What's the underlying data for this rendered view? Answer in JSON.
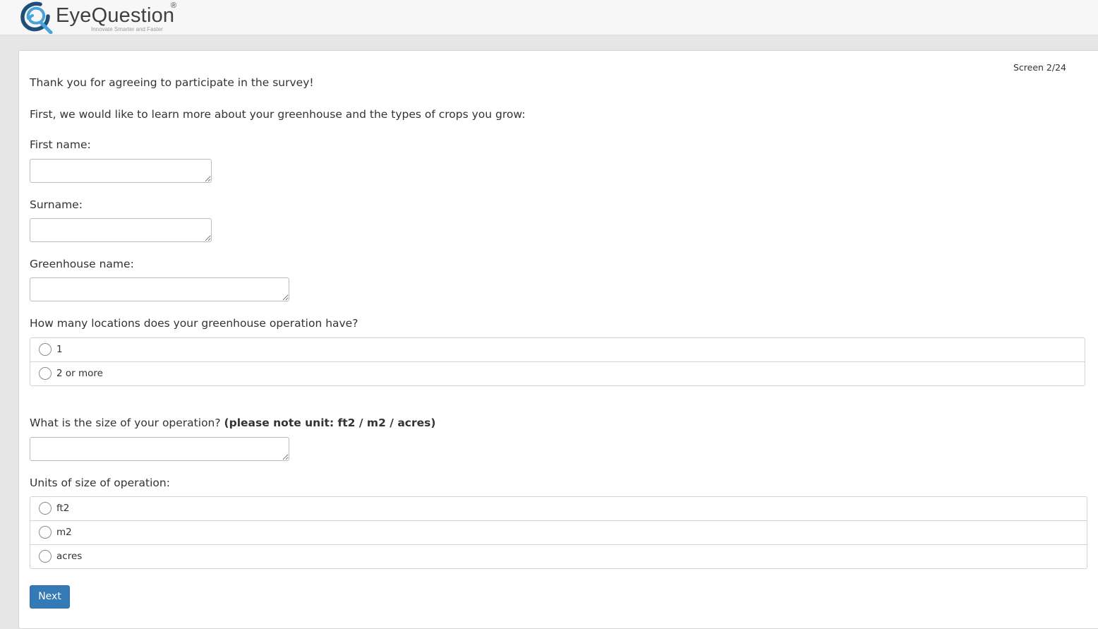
{
  "brand": {
    "logo_icon": "eyequestion-logo-mark",
    "name": "EyeQuestion",
    "registered": "®",
    "tagline": "Innovate Smarter and Faster",
    "colors": {
      "mark_dark": "#1d4f78",
      "mark_light": "#4aa3d8"
    }
  },
  "screen_counter": "Screen 2/24",
  "intro": {
    "thanks": "Thank you for agreeing to participate in the survey!",
    "lead": "First, we would like to learn more about your greenhouse and the types of crops you grow:"
  },
  "fields": {
    "first_name": {
      "label": "First name:",
      "value": ""
    },
    "surname": {
      "label": "Surname:",
      "value": ""
    },
    "greenhouse_name": {
      "label": "Greenhouse name:",
      "value": ""
    },
    "size": {
      "label": "What is the size of your operation?",
      "label_bold": "(please note unit: ft2 / m2 / acres)",
      "value": ""
    }
  },
  "locations": {
    "question": "How many locations does your greenhouse operation have?",
    "options": [
      "1",
      "2 or more"
    ],
    "selected": null
  },
  "units": {
    "question": "Units of size of operation:",
    "options": [
      "ft2",
      "m2",
      "acres"
    ],
    "selected": null
  },
  "next_button": "Next",
  "theme": {
    "primary": "#337ab7",
    "border": "#d2d2d2",
    "page_bg": "#e6e6e6"
  }
}
